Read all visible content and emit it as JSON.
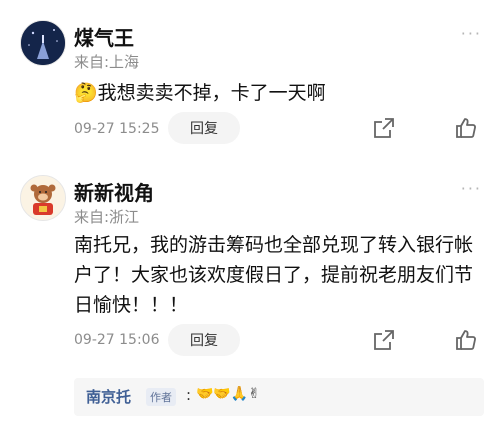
{
  "comments": [
    {
      "username": "煤气王",
      "location": "来自:上海",
      "emoji": "🤔",
      "text": "我想卖卖不掉，卡了一天啊",
      "time": "09-27 15:25",
      "reply_label": "回复",
      "more": "···"
    },
    {
      "username": "新新视角",
      "location": "来自:浙江",
      "text": "南托兄，我的游击筹码也全部兑现了转入银行帐户了！大家也该欢度假日了，提前祝老朋友们节日愉快！！！",
      "time": "09-27 15:06",
      "reply_label": "回复",
      "more": "···",
      "sub_reply": {
        "name": "南京托",
        "tag": "作者",
        "colon": ":",
        "emoji": "🤝🤝🙏✌"
      }
    }
  ],
  "colors": {
    "link_blue": "#3f5f95",
    "meta_gray": "#8c8c8c"
  },
  "icons": [
    "share-icon",
    "thumbs-up-icon",
    "more-icon"
  ]
}
